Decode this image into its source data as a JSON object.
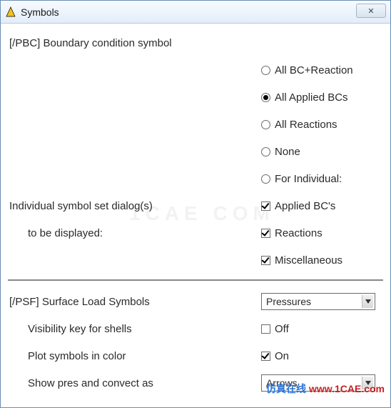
{
  "window": {
    "title": "Symbols"
  },
  "section1": {
    "heading": "[/PBC] Boundary condition symbol",
    "radios": {
      "all_bc_reaction": "All BC+Reaction",
      "all_applied": "All Applied BCs",
      "all_reactions": "All Reactions",
      "none": "None",
      "for_individual": "For Individual:"
    },
    "individual_line1": "Individual symbol set dialog(s)",
    "individual_line2": "to be displayed:",
    "checks": {
      "applied_bcs": "Applied BC's",
      "reactions": "Reactions",
      "misc": "Miscellaneous"
    }
  },
  "section2": {
    "heading": "[/PSF]  Surface Load Symbols",
    "select_value": "Pressures",
    "vis_label": "Visibility key for shells",
    "vis_value": "Off",
    "color_label": "Plot symbols in color",
    "color_value": "On",
    "pres_label": "Show pres and convect as",
    "pres_select": "Arrows"
  },
  "watermark": {
    "zh": "仿真在线",
    "url": "www.1CAE.com"
  },
  "bg_mark": "1CAE  COM",
  "close_glyph": "✕"
}
